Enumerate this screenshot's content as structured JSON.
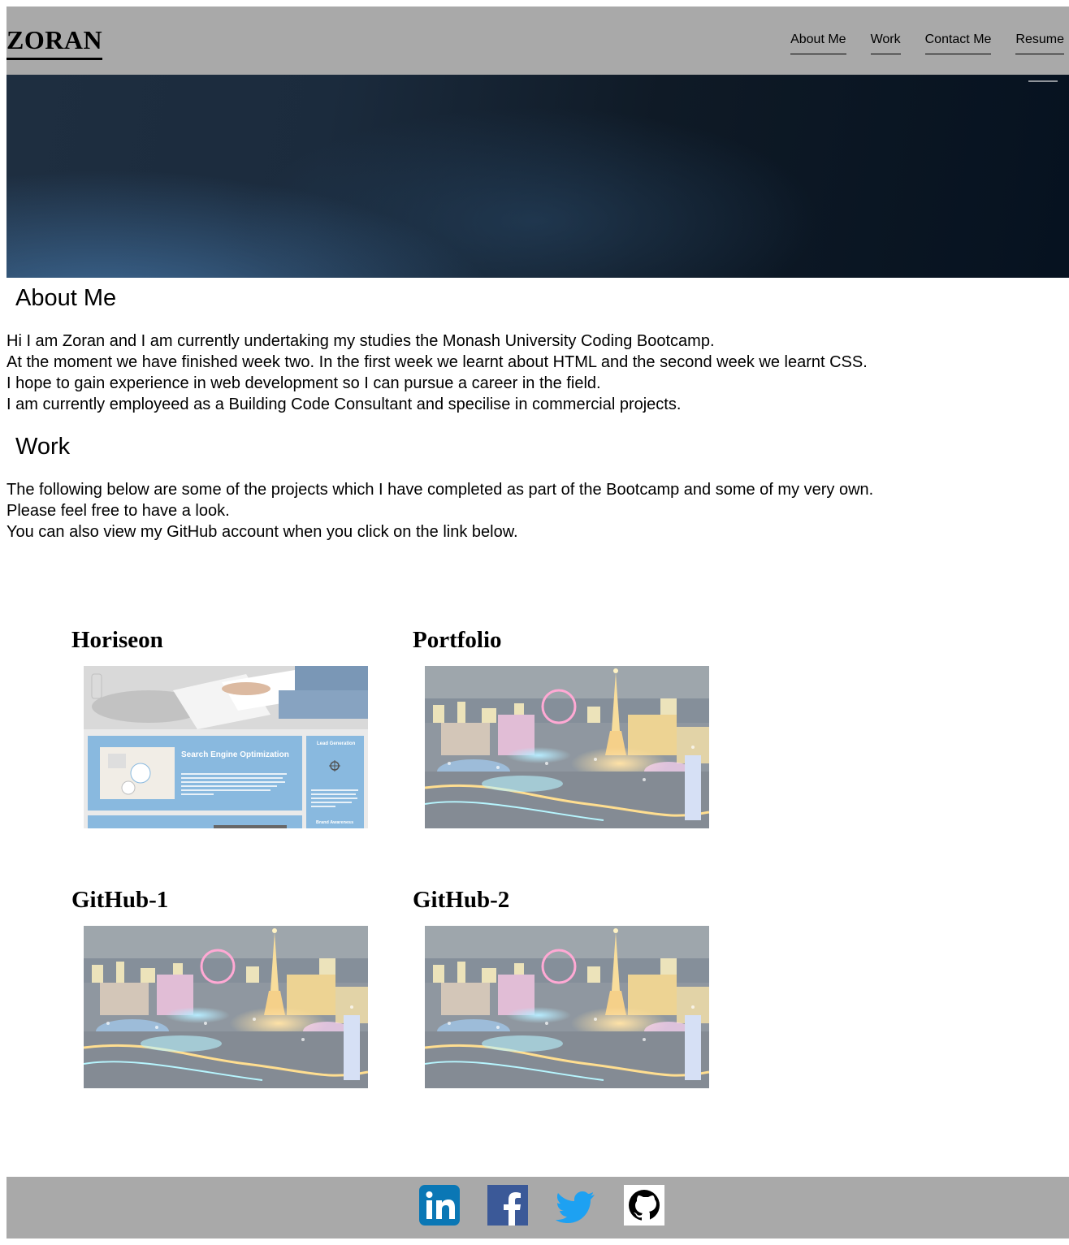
{
  "header": {
    "logo": "ZORAN",
    "nav": [
      "About Me",
      "Work",
      "Contact Me",
      "Resume"
    ]
  },
  "about": {
    "title": "About Me",
    "lines": [
      "Hi I am Zoran and I am currently undertaking my studies the Monash University Coding Bootcamp.",
      "At the moment we have finished week two. In the first week we learnt about HTML and the second week we learnt CSS.",
      "I hope to gain experience in web development so I can pursue a career in the field.",
      "I am currently employeed as a Building Code Consultant and specilise in commercial projects."
    ]
  },
  "work": {
    "title": "Work",
    "lines": [
      "The following below are some of the projects which I have completed as part of the Bootcamp and some of my very own.",
      "Please feel free to have a look.",
      "You can also view my GitHub account when you click on the link below."
    ],
    "projects": [
      {
        "title": "Horiseon",
        "image": "horiseon-screenshot",
        "seo_heading": "Search Engine Optimization",
        "lead_label": "Lead Generation",
        "brand_label": "Brand Awareness"
      },
      {
        "title": "Portfolio",
        "image": "las-vegas-night-photo"
      },
      {
        "title": "GitHub-1",
        "image": "las-vegas-night-photo"
      },
      {
        "title": "GitHub-2",
        "image": "las-vegas-night-photo"
      }
    ]
  },
  "footer": {
    "icons": [
      "linkedin-icon",
      "facebook-icon",
      "twitter-icon",
      "github-icon"
    ],
    "colors": {
      "linkedin": "#0a77b5",
      "facebook": "#3b5998",
      "twitter": "#1da1f2",
      "github": "#000000"
    }
  }
}
